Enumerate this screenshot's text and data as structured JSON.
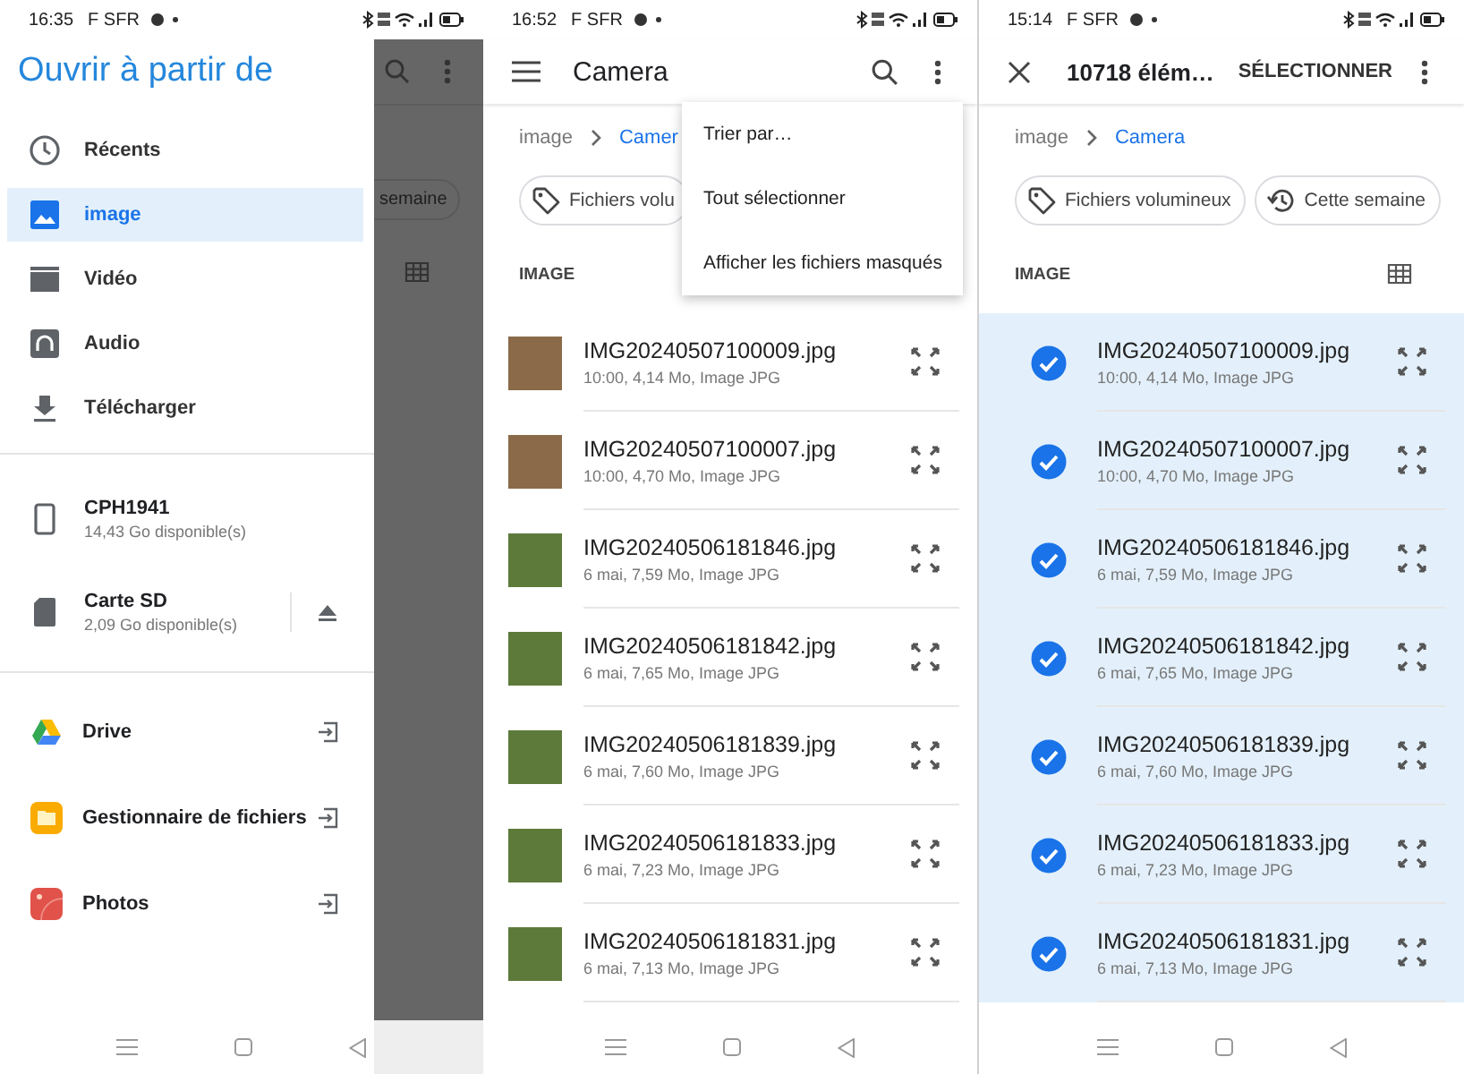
{
  "screens": [
    {
      "kind": "drawer",
      "status_bar": {
        "time": "16:35",
        "carrier": "F SFR"
      },
      "title": "Ouvrir à partir de",
      "places": [
        {
          "label": "Récents",
          "selected": false
        },
        {
          "label": "image",
          "selected": true
        },
        {
          "label": "Vidéo",
          "selected": false
        },
        {
          "label": "Audio",
          "selected": false
        },
        {
          "label": "Télécharger",
          "selected": false
        }
      ],
      "devices": [
        {
          "name": "CPH1941",
          "free": "14,43 Go disponible(s)",
          "ejectable": false
        },
        {
          "name": "Carte SD",
          "free": "2,09 Go disponible(s)",
          "ejectable": true
        }
      ],
      "apps": [
        {
          "label": "Drive"
        },
        {
          "label": "Gestionnaire de fichiers"
        },
        {
          "label": "Photos"
        }
      ],
      "behind_chip": "semaine"
    },
    {
      "kind": "browser",
      "status_bar": {
        "time": "16:52",
        "carrier": "F SFR"
      },
      "toolbar": {
        "title": "Camera"
      },
      "breadcrumb": [
        "image",
        "Camer"
      ],
      "chips": [
        "Fichiers volu"
      ],
      "section": "IMAGE",
      "view_toggle": false,
      "files": [
        {
          "name": "IMG20240507100009.jpg",
          "meta": "10:00, 4,14 Mo, Image JPG",
          "color": "#8a6a48",
          "selected": false
        },
        {
          "name": "IMG20240507100007.jpg",
          "meta": "10:00, 4,70 Mo, Image JPG",
          "color": "#8a6a48",
          "selected": false
        },
        {
          "name": "IMG20240506181846.jpg",
          "meta": "6 mai, 7,59 Mo, Image JPG",
          "color": "#5d7a3a",
          "selected": false
        },
        {
          "name": "IMG20240506181842.jpg",
          "meta": "6 mai, 7,65 Mo, Image JPG",
          "color": "#5d7a3a",
          "selected": false
        },
        {
          "name": "IMG20240506181839.jpg",
          "meta": "6 mai, 7,60 Mo, Image JPG",
          "color": "#5d7a3a",
          "selected": false
        },
        {
          "name": "IMG20240506181833.jpg",
          "meta": "6 mai, 7,23 Mo, Image JPG",
          "color": "#5d7a3a",
          "selected": false
        },
        {
          "name": "IMG20240506181831.jpg",
          "meta": "6 mai, 7,13 Mo, Image JPG",
          "color": "#5d7a3a",
          "selected": false
        }
      ],
      "menu": [
        "Trier par…",
        "Tout sélectionner",
        "Afficher les fichiers masqués"
      ]
    },
    {
      "kind": "selection",
      "status_bar": {
        "time": "15:14",
        "carrier": "F SFR"
      },
      "toolbar": {
        "title": "10718 élém…",
        "action": "SÉLECTIONNER"
      },
      "breadcrumb": [
        "image",
        "Camera"
      ],
      "chips": [
        "Fichiers volumineux",
        "Cette semaine"
      ],
      "section": "IMAGE",
      "view_toggle": true,
      "files": [
        {
          "name": "IMG20240507100009.jpg",
          "meta": "10:00, 4,14 Mo, Image JPG",
          "selected": true
        },
        {
          "name": "IMG20240507100007.jpg",
          "meta": "10:00, 4,70 Mo, Image JPG",
          "selected": true
        },
        {
          "name": "IMG20240506181846.jpg",
          "meta": "6 mai, 7,59 Mo, Image JPG",
          "selected": true
        },
        {
          "name": "IMG20240506181842.jpg",
          "meta": "6 mai, 7,65 Mo, Image JPG",
          "selected": true
        },
        {
          "name": "IMG20240506181839.jpg",
          "meta": "6 mai, 7,60 Mo, Image JPG",
          "selected": true
        },
        {
          "name": "IMG20240506181833.jpg",
          "meta": "6 mai, 7,23 Mo, Image JPG",
          "selected": true
        },
        {
          "name": "IMG20240506181831.jpg",
          "meta": "6 mai, 7,13 Mo, Image JPG",
          "selected": true
        }
      ]
    }
  ]
}
